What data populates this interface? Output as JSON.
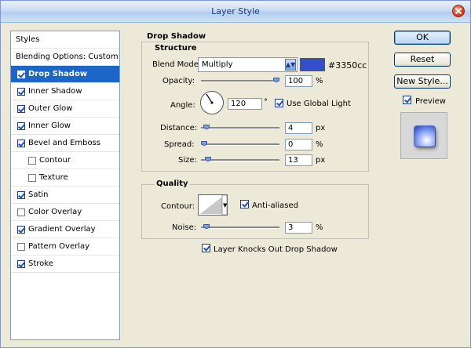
{
  "window": {
    "title": "Layer Style"
  },
  "styles_panel": {
    "header": "Styles",
    "items": [
      {
        "label": "Blending Options: Custom",
        "checkbox": null,
        "selected": false
      },
      {
        "label": "Drop Shadow",
        "checkbox": true,
        "selected": true
      },
      {
        "label": "Inner Shadow",
        "checkbox": true,
        "selected": false
      },
      {
        "label": "Outer Glow",
        "checkbox": true,
        "selected": false
      },
      {
        "label": "Inner Glow",
        "checkbox": true,
        "selected": false
      },
      {
        "label": "Bevel and Emboss",
        "checkbox": true,
        "selected": false
      },
      {
        "label": "Contour",
        "checkbox": false,
        "selected": false,
        "indent": true
      },
      {
        "label": "Texture",
        "checkbox": false,
        "selected": false,
        "indent": true
      },
      {
        "label": "Satin",
        "checkbox": true,
        "selected": false
      },
      {
        "label": "Color Overlay",
        "checkbox": false,
        "selected": false
      },
      {
        "label": "Gradient Overlay",
        "checkbox": true,
        "selected": false
      },
      {
        "label": "Pattern Overlay",
        "checkbox": false,
        "selected": false
      },
      {
        "label": "Stroke",
        "checkbox": true,
        "selected": false
      }
    ]
  },
  "drop_shadow": {
    "title": "Drop Shadow",
    "structure": {
      "title": "Structure",
      "blend_mode_label": "Blend Mode:",
      "blend_mode_value": "Multiply",
      "color_hex": "#3350cc",
      "color_label": "#3350cc",
      "opacity_label": "Opacity:",
      "opacity_value": "100",
      "opacity_unit": "%",
      "angle_label": "Angle:",
      "angle_value": "120",
      "angle_unit": "°",
      "global_light_label": "Use Global Light",
      "global_light_checked": true,
      "distance_label": "Distance:",
      "distance_value": "4",
      "distance_unit": "px",
      "spread_label": "Spread:",
      "spread_value": "0",
      "spread_unit": "%",
      "size_label": "Size:",
      "size_value": "13",
      "size_unit": "px"
    },
    "quality": {
      "title": "Quality",
      "contour_label": "Contour:",
      "anti_aliased_label": "Anti-aliased",
      "anti_aliased_checked": true,
      "noise_label": "Noise:",
      "noise_value": "3",
      "noise_unit": "%"
    },
    "knockout_label": "Layer Knocks Out Drop Shadow",
    "knockout_checked": true
  },
  "buttons": {
    "ok": "OK",
    "reset": "Reset",
    "new_style": "New Style...",
    "preview_label": "Preview",
    "preview_checked": true
  },
  "sliders": {
    "opacity": 1.0,
    "distance": 0.03,
    "spread": 0.0,
    "size": 0.05,
    "noise": 0.03
  },
  "colors": {
    "accent": "#1c65c9",
    "shadow": "#3350cc"
  }
}
